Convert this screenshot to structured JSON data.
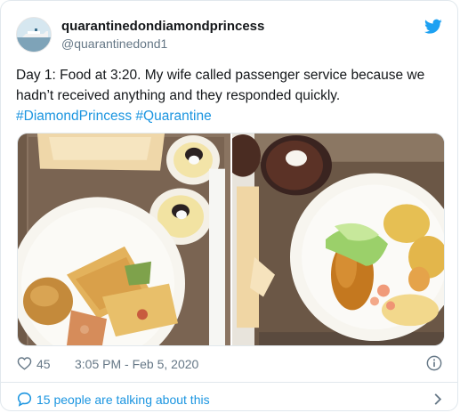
{
  "tweet": {
    "display_name": "quarantinedondiamondprincess",
    "handle": "@quarantinedond1",
    "text_main": "Day 1: Food at 3:20. My wife called passenger service because we hadn’t  received anything and they responded quickly.",
    "hashtag_1": "#DiamondPrincess",
    "hashtag_2": "#Quarantine",
    "like_count": "45",
    "timestamp": "3:05 PM - Feb 5, 2020",
    "conversation_text": "15 people are talking about this"
  },
  "colors": {
    "brand": "#1da1f2",
    "link": "#1b95e0",
    "secondary_text": "#657786",
    "border": "#e1e8ed"
  },
  "icons": {
    "brand": "twitter-bird-icon",
    "like": "heart-outline-icon",
    "info": "info-circle-icon",
    "reply": "speech-bubble-icon",
    "chevron": "chevron-right-icon"
  }
}
